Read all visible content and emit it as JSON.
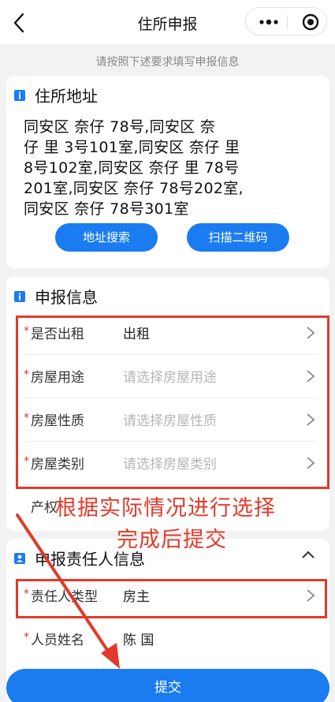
{
  "nav": {
    "title": "住所申报"
  },
  "hint": "请按照下述要求填写申报信息",
  "address_section": {
    "title": "住所地址",
    "lines": [
      "同安区     奈仔    78号,同安区      奈",
      "仔    里    3号101室,同安区      奈仔    里",
      "    8号102室,同安区      奈仔    里    78号",
      "201室,同安区      奈仔        78号202室,",
      "同安区      奈仔        78号301室"
    ],
    "search_button": "地址搜索",
    "scan_button": "扫描二维码"
  },
  "declaration_section": {
    "title": "申报信息",
    "fields": [
      {
        "label": "是否出租",
        "value": "出租",
        "required": true,
        "placeholder": false
      },
      {
        "label": "房屋用途",
        "value": "请选择房屋用途",
        "required": true,
        "placeholder": true
      },
      {
        "label": "房屋性质",
        "value": "请选择房屋性质",
        "required": true,
        "placeholder": true
      },
      {
        "label": "房屋类别",
        "value": "请选择房屋类别",
        "required": true,
        "placeholder": true
      },
      {
        "label": "产权",
        "value": "",
        "required": false,
        "placeholder": false
      }
    ]
  },
  "responsible_section": {
    "title": "申报责任人信息",
    "fields": [
      {
        "label": "责任人类型",
        "value": "房主",
        "required": true
      },
      {
        "label": "人员姓名",
        "value": "陈  国",
        "required": true
      }
    ]
  },
  "annotation": {
    "line1": "根据实际情况进行选择",
    "line2": "完成后提交"
  },
  "submit_button": "提交",
  "colors": {
    "accent": "#1a7cf0",
    "annotation_red": "#e23a2a",
    "required_star": "#e0342c"
  },
  "icons": [
    "back-icon",
    "more-icon",
    "target-icon",
    "info-icon",
    "chevron-right-icon",
    "chevron-up-icon",
    "person-icon",
    "arrow-icon"
  ]
}
